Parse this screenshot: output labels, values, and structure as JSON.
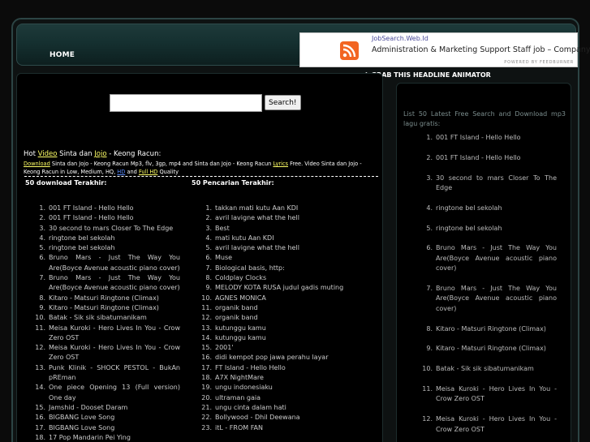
{
  "nav": {
    "home": "HOME"
  },
  "feed": {
    "source": "JobSearch.Web.Id",
    "headline": "Administration & Marketing Support Staff job – Company",
    "powered": "POWERED BY FEEDBURNER",
    "grab": "↑ GRAB THIS HEADLINE ANIMATOR"
  },
  "search": {
    "placeholder": "",
    "button": "Search!"
  },
  "hot": {
    "prefix": "Hot ",
    "video": "Video",
    "t1": " Sinta dan ",
    "jojo": "Jojo",
    "t2": " - Keong Racun:",
    "d_download": "Download",
    "d1": " Sinta dan Jojo - Keong Racun Mp3, flv, 3gp, mp4 and Sinta dan Jojo - Keong Racun ",
    "d_lyrics": "Lyrics",
    "d2": " Free. Video Sinta dan Jojo - Keong Racun in Low, Medium, HQ, ",
    "d_hd": "HD",
    "d3": " and ",
    "d_fullhd": "Full HD",
    "d4": " Quality"
  },
  "left_heading": "50 download Terakhir:",
  "right_heading": "50 Pencarian Terakhir:",
  "left_list": [
    {
      "n": "1.",
      "t": "001 FT Island - Hello Hello"
    },
    {
      "n": "2.",
      "t": "001 FT Island - Hello Hello"
    },
    {
      "n": "3.",
      "t": "30 second to mars Closer To The Edge"
    },
    {
      "n": "4.",
      "t": "ringtone bel sekolah"
    },
    {
      "n": "5.",
      "t": "ringtone bel sekolah"
    },
    {
      "n": "6.",
      "t": "Bruno Mars - Just The Way You Are(Boyce Avenue acoustic piano cover)"
    },
    {
      "n": "7.",
      "t": "Bruno Mars - Just The Way You Are(Boyce Avenue acoustic piano cover)"
    },
    {
      "n": "8.",
      "t": "Kitaro - Matsuri Ringtone (Climax)"
    },
    {
      "n": "9.",
      "t": "Kitaro - Matsuri Ringtone (Climax)"
    },
    {
      "n": "10.",
      "t": "Batak - Sik sik sibatumanikam"
    },
    {
      "n": "11.",
      "t": "Meisa Kuroki - Hero Lives In You - Crow Zero OST"
    },
    {
      "n": "12.",
      "t": "Meisa Kuroki - Hero Lives In You - Crow Zero OST"
    },
    {
      "n": "13.",
      "t": "Punk Klinik - SHOCK PESTOL - BukAn pREman"
    },
    {
      "n": "14.",
      "t": "One piece Opening 13 (Full version) One day"
    },
    {
      "n": "15.",
      "t": "Jamshid - Dooset Daram"
    },
    {
      "n": "16.",
      "t": "BIGBANG Love Song"
    },
    {
      "n": "17.",
      "t": "BIGBANG Love Song"
    },
    {
      "n": "18.",
      "t": "17 Pop Mandarin Pei Ying"
    }
  ],
  "right_list": [
    {
      "n": "1.",
      "t": "takkan mati kutu Aan KDI"
    },
    {
      "n": "2.",
      "t": "avril lavigne what the hell"
    },
    {
      "n": "3.",
      "t": "Best"
    },
    {
      "n": "4.",
      "t": "mati kutu Aan KDI"
    },
    {
      "n": "5.",
      "t": "avril lavigne what the hell"
    },
    {
      "n": "6.",
      "t": "Muse"
    },
    {
      "n": "7.",
      "t": "Biological basis, http:"
    },
    {
      "n": "8.",
      "t": "Coldplay Clocks"
    },
    {
      "n": "9.",
      "t": "MELODY KOTA RUSA judul gadis muting"
    },
    {
      "n": "10.",
      "t": "AGNES MONICA"
    },
    {
      "n": "11.",
      "t": "organik band"
    },
    {
      "n": "12.",
      "t": "organik band"
    },
    {
      "n": "13.",
      "t": "kutunggu kamu"
    },
    {
      "n": "14.",
      "t": "kutunggu kamu"
    },
    {
      "n": "15.",
      "t": "2001'"
    },
    {
      "n": "16.",
      "t": "didi kempot pop jawa perahu layar"
    },
    {
      "n": "17.",
      "t": "FT Island - Hello Hello"
    },
    {
      "n": "18.",
      "t": "A7X NightMare"
    },
    {
      "n": "19.",
      "t": "ungu indonesiaku"
    },
    {
      "n": "20.",
      "t": "ultraman gaia"
    },
    {
      "n": "21.",
      "t": "ungu cinta dalam hati"
    },
    {
      "n": "22.",
      "t": "Bollywood - Dhil Deewana"
    },
    {
      "n": "23.",
      "t": "itL - FROM FAN"
    }
  ],
  "side": {
    "intro": "List 50 Latest Free Search and Download mp3 lagu gratis:",
    "items": [
      {
        "n": "1.",
        "t": "001 FT Island - Hello Hello"
      },
      {
        "n": "2.",
        "t": "001 FT Island - Hello Hello"
      },
      {
        "n": "3.",
        "t": "30 second to mars Closer To The Edge"
      },
      {
        "n": "4.",
        "t": "ringtone bel sekolah"
      },
      {
        "n": "5.",
        "t": "ringtone bel sekolah"
      },
      {
        "n": "6.",
        "t": "Bruno Mars - Just The Way You Are(Boyce Avenue acoustic piano cover)"
      },
      {
        "n": "7.",
        "t": "Bruno Mars - Just The Way You Are(Boyce Avenue acoustic piano cover)"
      },
      {
        "n": "8.",
        "t": "Kitaro - Matsuri Ringtone (Climax)"
      },
      {
        "n": "9.",
        "t": "Kitaro - Matsuri Ringtone (Climax)"
      },
      {
        "n": "10.",
        "t": "Batak - Sik sik sibatumanikam"
      },
      {
        "n": "11.",
        "t": "Meisa Kuroki - Hero Lives In You - Crow Zero OST"
      },
      {
        "n": "12.",
        "t": "Meisa Kuroki - Hero Lives In You - Crow Zero OST"
      }
    ]
  }
}
